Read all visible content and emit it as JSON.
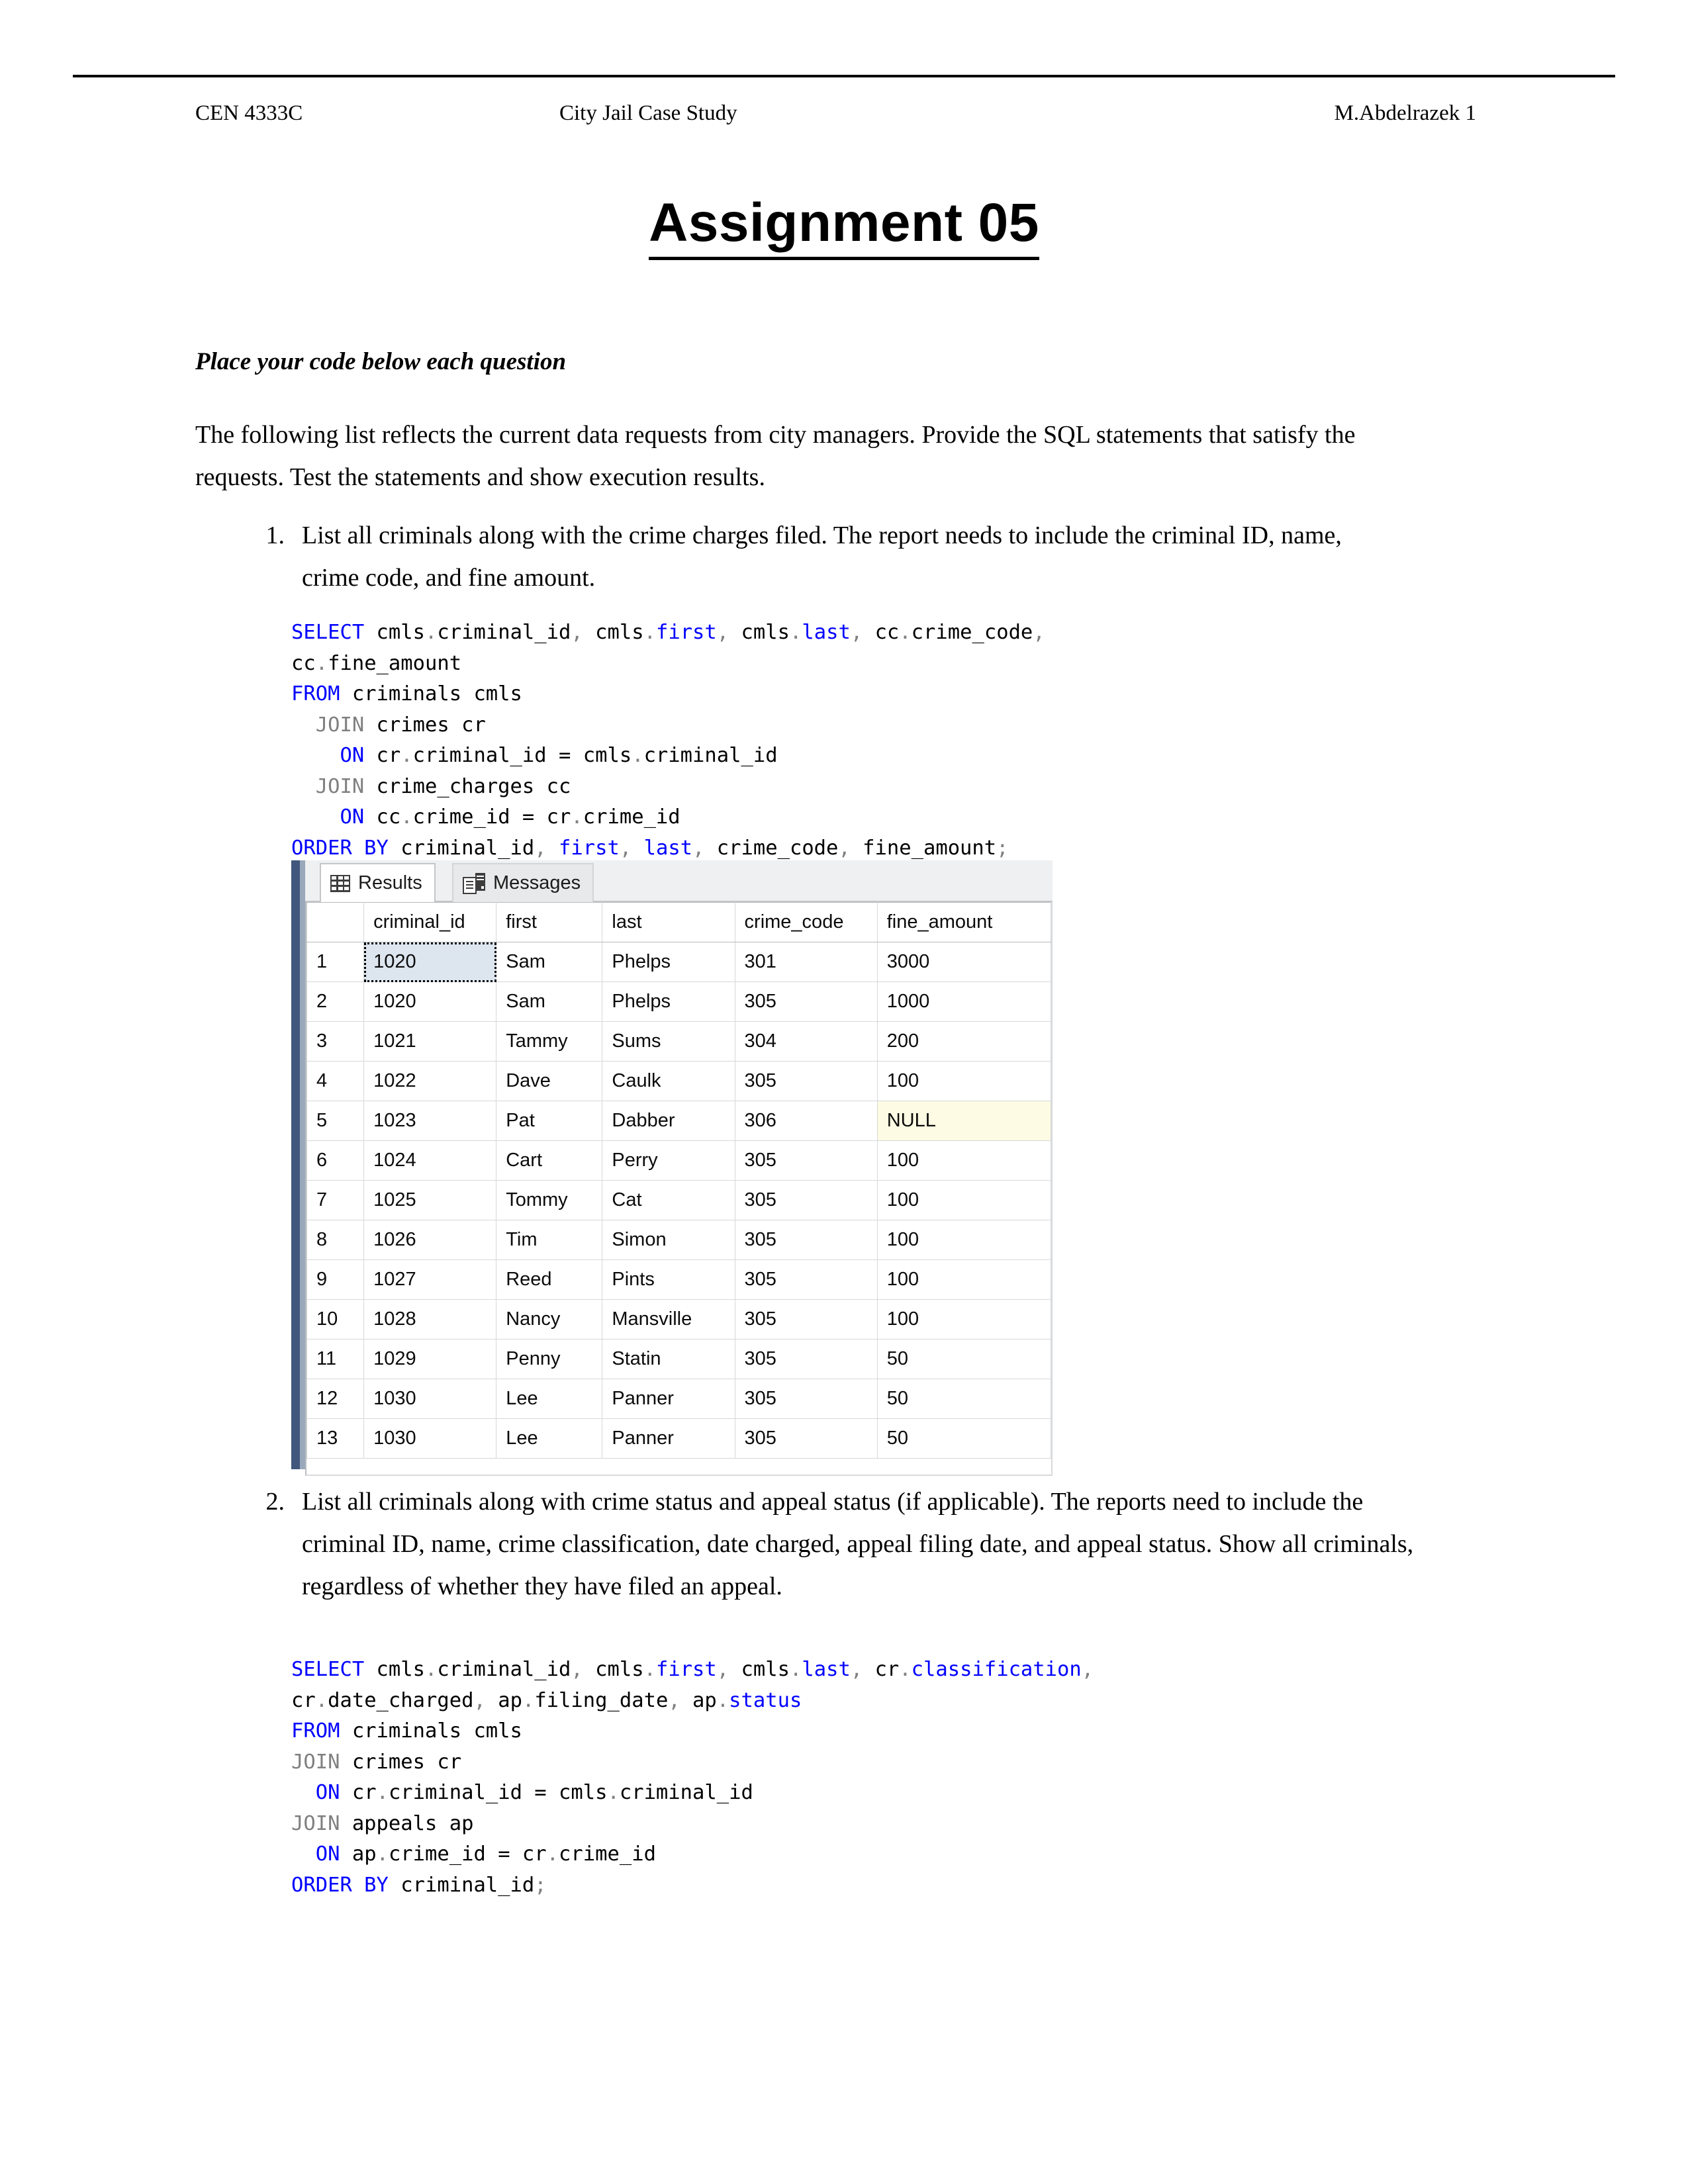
{
  "header": {
    "course": "CEN 4333C",
    "subject": "City Jail Case Study",
    "author_page": "M.Abdelrazek 1"
  },
  "title": "Assignment 05",
  "intro": {
    "instruction": "Place your code below each question",
    "paragraph": "The following list reflects the current data requests from city managers. Provide the SQL statements that satisfy the requests. Test the statements and show execution results."
  },
  "questions": [
    {
      "number": "1.",
      "text": "List all criminals along with the crime charges filed. The report needs to include the criminal ID, name, crime code, and fine amount.",
      "sql_lines": [
        [
          {
            "t": "SELECT",
            "c": "kw"
          },
          {
            "t": " cmls",
            "c": ""
          },
          {
            "t": ".",
            "c": "pn"
          },
          {
            "t": "criminal_id",
            "c": ""
          },
          {
            "t": ",",
            "c": "pn"
          },
          {
            "t": " cmls",
            "c": ""
          },
          {
            "t": ".",
            "c": "pn"
          },
          {
            "t": "first",
            "c": "id"
          },
          {
            "t": ",",
            "c": "pn"
          },
          {
            "t": " cmls",
            "c": ""
          },
          {
            "t": ".",
            "c": "pn"
          },
          {
            "t": "last",
            "c": "id"
          },
          {
            "t": ",",
            "c": "pn"
          },
          {
            "t": " cc",
            "c": ""
          },
          {
            "t": ".",
            "c": "pn"
          },
          {
            "t": "crime_code",
            "c": ""
          },
          {
            "t": ",",
            "c": "pn"
          }
        ],
        [
          {
            "t": "cc",
            "c": ""
          },
          {
            "t": ".",
            "c": "pn"
          },
          {
            "t": "fine_amount",
            "c": ""
          }
        ],
        [
          {
            "t": "FROM",
            "c": "kw"
          },
          {
            "t": " criminals cmls",
            "c": ""
          }
        ],
        [
          {
            "t": "  ",
            "c": ""
          },
          {
            "t": "JOIN",
            "c": "jn"
          },
          {
            "t": " crimes cr",
            "c": ""
          }
        ],
        [
          {
            "t": "    ",
            "c": ""
          },
          {
            "t": "ON",
            "c": "kw"
          },
          {
            "t": " cr",
            "c": ""
          },
          {
            "t": ".",
            "c": "pn"
          },
          {
            "t": "criminal_id = cmls",
            "c": ""
          },
          {
            "t": ".",
            "c": "pn"
          },
          {
            "t": "criminal_id",
            "c": ""
          }
        ],
        [
          {
            "t": "  ",
            "c": ""
          },
          {
            "t": "JOIN",
            "c": "jn"
          },
          {
            "t": " crime_charges cc",
            "c": ""
          }
        ],
        [
          {
            "t": "    ",
            "c": ""
          },
          {
            "t": "ON",
            "c": "kw"
          },
          {
            "t": " cc",
            "c": ""
          },
          {
            "t": ".",
            "c": "pn"
          },
          {
            "t": "crime_id = cr",
            "c": ""
          },
          {
            "t": ".",
            "c": "pn"
          },
          {
            "t": "crime_id",
            "c": ""
          }
        ],
        [
          {
            "t": "ORDER BY",
            "c": "kw"
          },
          {
            "t": " criminal_id",
            "c": ""
          },
          {
            "t": ",",
            "c": "pn"
          },
          {
            "t": " ",
            "c": ""
          },
          {
            "t": "first",
            "c": "id"
          },
          {
            "t": ",",
            "c": "pn"
          },
          {
            "t": " ",
            "c": ""
          },
          {
            "t": "last",
            "c": "id"
          },
          {
            "t": ",",
            "c": "pn"
          },
          {
            "t": " crime_code",
            "c": ""
          },
          {
            "t": ",",
            "c": "pn"
          },
          {
            "t": " fine_amount",
            "c": ""
          },
          {
            "t": ";",
            "c": "pn"
          }
        ]
      ]
    },
    {
      "number": "2.",
      "text": "List all criminals along with crime status and appeal status (if applicable). The reports need to include the criminal ID, name, crime classification, date charged, appeal filing date, and appeal status. Show all criminals, regardless of whether they have filed an appeal.",
      "sql_lines": [
        [
          {
            "t": "SELECT",
            "c": "kw"
          },
          {
            "t": " cmls",
            "c": ""
          },
          {
            "t": ".",
            "c": "pn"
          },
          {
            "t": "criminal_id",
            "c": ""
          },
          {
            "t": ",",
            "c": "pn"
          },
          {
            "t": " cmls",
            "c": ""
          },
          {
            "t": ".",
            "c": "pn"
          },
          {
            "t": "first",
            "c": "id"
          },
          {
            "t": ",",
            "c": "pn"
          },
          {
            "t": " cmls",
            "c": ""
          },
          {
            "t": ".",
            "c": "pn"
          },
          {
            "t": "last",
            "c": "id"
          },
          {
            "t": ",",
            "c": "pn"
          },
          {
            "t": " cr",
            "c": ""
          },
          {
            "t": ".",
            "c": "pn"
          },
          {
            "t": "classification",
            "c": "id"
          },
          {
            "t": ",",
            "c": "pn"
          }
        ],
        [
          {
            "t": "cr",
            "c": ""
          },
          {
            "t": ".",
            "c": "pn"
          },
          {
            "t": "date_charged",
            "c": ""
          },
          {
            "t": ",",
            "c": "pn"
          },
          {
            "t": " ap",
            "c": ""
          },
          {
            "t": ".",
            "c": "pn"
          },
          {
            "t": "filing_date",
            "c": ""
          },
          {
            "t": ",",
            "c": "pn"
          },
          {
            "t": " ap",
            "c": ""
          },
          {
            "t": ".",
            "c": "pn"
          },
          {
            "t": "status",
            "c": "id"
          }
        ],
        [
          {
            "t": "FROM",
            "c": "kw"
          },
          {
            "t": " criminals cmls",
            "c": ""
          }
        ],
        [
          {
            "t": "JOIN",
            "c": "jn"
          },
          {
            "t": " crimes cr",
            "c": ""
          }
        ],
        [
          {
            "t": "  ",
            "c": ""
          },
          {
            "t": "ON",
            "c": "kw"
          },
          {
            "t": " cr",
            "c": ""
          },
          {
            "t": ".",
            "c": "pn"
          },
          {
            "t": "criminal_id = cmls",
            "c": ""
          },
          {
            "t": ".",
            "c": "pn"
          },
          {
            "t": "criminal_id",
            "c": ""
          }
        ],
        [
          {
            "t": "JOIN",
            "c": "jn"
          },
          {
            "t": " appeals ap",
            "c": ""
          }
        ],
        [
          {
            "t": "  ",
            "c": ""
          },
          {
            "t": "ON",
            "c": "kw"
          },
          {
            "t": " ap",
            "c": ""
          },
          {
            "t": ".",
            "c": "pn"
          },
          {
            "t": "crime_id = cr",
            "c": ""
          },
          {
            "t": ".",
            "c": "pn"
          },
          {
            "t": "crime_id",
            "c": ""
          }
        ],
        [
          {
            "t": "ORDER BY",
            "c": "kw"
          },
          {
            "t": " criminal_id",
            "c": ""
          },
          {
            "t": ";",
            "c": "pn"
          }
        ]
      ]
    }
  ],
  "results_pane": {
    "tabs": [
      {
        "label": "Results",
        "icon": "grid-icon",
        "active": true
      },
      {
        "label": "Messages",
        "icon": "messages-icon",
        "active": false
      }
    ],
    "columns": [
      "criminal_id",
      "first",
      "last",
      "crime_code",
      "fine_amount"
    ],
    "rows": [
      {
        "n": "1",
        "criminal_id": "1020",
        "first": "Sam",
        "last": "Phelps",
        "crime_code": "301",
        "fine_amount": "3000",
        "selected": true
      },
      {
        "n": "2",
        "criminal_id": "1020",
        "first": "Sam",
        "last": "Phelps",
        "crime_code": "305",
        "fine_amount": "1000"
      },
      {
        "n": "3",
        "criminal_id": "1021",
        "first": "Tammy",
        "last": "Sums",
        "crime_code": "304",
        "fine_amount": "200"
      },
      {
        "n": "4",
        "criminal_id": "1022",
        "first": "Dave",
        "last": "Caulk",
        "crime_code": "305",
        "fine_amount": "100"
      },
      {
        "n": "5",
        "criminal_id": "1023",
        "first": "Pat",
        "last": "Dabber",
        "crime_code": "306",
        "fine_amount": "NULL",
        "is_null": true
      },
      {
        "n": "6",
        "criminal_id": "1024",
        "first": "Cart",
        "last": "Perry",
        "crime_code": "305",
        "fine_amount": "100"
      },
      {
        "n": "7",
        "criminal_id": "1025",
        "first": "Tommy",
        "last": "Cat",
        "crime_code": "305",
        "fine_amount": "100"
      },
      {
        "n": "8",
        "criminal_id": "1026",
        "first": "Tim",
        "last": "Simon",
        "crime_code": "305",
        "fine_amount": "100"
      },
      {
        "n": "9",
        "criminal_id": "1027",
        "first": "Reed",
        "last": "Pints",
        "crime_code": "305",
        "fine_amount": "100"
      },
      {
        "n": "10",
        "criminal_id": "1028",
        "first": "Nancy",
        "last": "Mansville",
        "crime_code": "305",
        "fine_amount": "100"
      },
      {
        "n": "11",
        "criminal_id": "1029",
        "first": "Penny",
        "last": "Statin",
        "crime_code": "305",
        "fine_amount": "50"
      },
      {
        "n": "12",
        "criminal_id": "1030",
        "first": "Lee",
        "last": "Panner",
        "crime_code": "305",
        "fine_amount": "50"
      },
      {
        "n": "13",
        "criminal_id": "1030",
        "first": "Lee",
        "last": "Panner",
        "crime_code": "305",
        "fine_amount": "50"
      }
    ]
  },
  "colors": {
    "sql_keyword": "#0000ff",
    "sql_join": "#808080",
    "null_cell_bg": "#fdfbe3",
    "selected_cell_bg": "#dde5ef",
    "window_edge": "#41587c"
  }
}
